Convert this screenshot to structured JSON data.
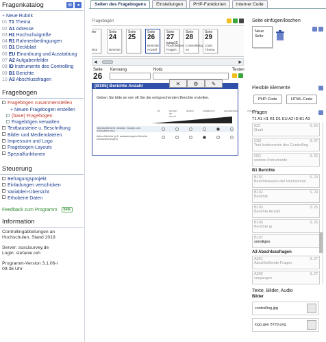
{
  "left": {
    "catalog_title": "Fragenkatalog",
    "catalog": [
      {
        "num": "",
        "code": "",
        "label": "Neue Rubrik",
        "new": true
      },
      {
        "num": "01",
        "code": "T1",
        "label": "Thema"
      },
      {
        "num": "02",
        "code": "A1",
        "label": "Adresse"
      },
      {
        "num": "03",
        "code": "H1",
        "label": "Hochschulgröße"
      },
      {
        "num": "04",
        "code": "R1",
        "label": "Rahmenbedingungen"
      },
      {
        "num": "05",
        "code": "D1",
        "label": "Deckblatt"
      },
      {
        "num": "06",
        "code": "EU",
        "label": "Einordnung und Ausstattung"
      },
      {
        "num": "07",
        "code": "A2",
        "label": "Aufgabenfelder"
      },
      {
        "num": "08",
        "code": "ID",
        "label": "Instrumente des Controlling"
      },
      {
        "num": "09",
        "code": "B1",
        "label": "Berichte"
      },
      {
        "num": "10",
        "code": "A3",
        "label": "Abschlussfragen"
      }
    ],
    "questionnaire_title": "Fragebogen",
    "nav1": [
      {
        "label": "Fragebögen zusammenstellen",
        "level": 0,
        "active": true
      },
      {
        "label": "+ Neuen Fragebogen erstellen",
        "level": 2
      },
      {
        "label": "(base) Fragebogen",
        "level": 1,
        "active": true
      },
      {
        "label": "Fragebögen verwalten",
        "level": 1
      },
      {
        "label": "Textbausteine u. Beschriftung",
        "level": 0
      },
      {
        "label": "Bilder und Mediendateien",
        "level": 0
      },
      {
        "label": "Impressum und Logo",
        "level": 0
      },
      {
        "label": "Fragebogen-Layouts",
        "level": 0
      },
      {
        "label": "Spezialfunktionen",
        "level": 0
      }
    ],
    "control_title": "Steuerung",
    "nav2": [
      {
        "label": "Befragungsprojekt"
      },
      {
        "label": "Einladungen verschicken"
      },
      {
        "label": "Variablen-Übersicht"
      },
      {
        "label": "Erhobene Daten"
      }
    ],
    "feedback": "Feedback zum Programm",
    "beta": "beta",
    "info_title": "Information",
    "info_lines": [
      "Controllingabteilungen an Hochschulen, Stand 2019",
      "Server: soscisurvey.de\nLogin: stefanie.reh",
      "Programm-Version 3.1.06-i\n09:36 Uhr"
    ]
  },
  "tabs": [
    "Seiten des Fragebogens",
    "Einstellungen",
    "PHP-Funktionen",
    "Interner Code"
  ],
  "editor": {
    "questionnaire_label": "Fragebogen",
    "page_label": "Seite",
    "pages": [
      {
        "num": "",
        "var": "",
        "desc": "rweise"
      },
      {
        "num": "24",
        "var": "",
        "desc": "Berichte"
      },
      {
        "num": "25",
        "var": "",
        "desc": ""
      },
      {
        "num": "26",
        "var": "",
        "desc": "Berichte Anzahl"
      },
      {
        "num": "27",
        "var": "jump10",
        "desc": "Abschließende Fragen"
      },
      {
        "num": "28",
        "var": "",
        "desc": "Controllertag es"
      },
      {
        "num": "29",
        "var": "",
        "desc": "Contr Thema"
      }
    ],
    "current_page": "26",
    "kennung_label": "Kennung",
    "notiz_label": "Notiz",
    "testen_label": "Testen",
    "question_title": "[B105] Berichte Anzahl",
    "question_text": "Geben Sie bitte an wie oft Sie die entsprechenden Berichte erstellen.",
    "scale_labels": [
      "nie",
      "weniger als einmal",
      "jährlich",
      "halbjährlich",
      "quartalsweise",
      "monatlich"
    ],
    "rows": [
      {
        "text": "Standardberichte (Analyse, Budget- und Kennzahlen etc.)",
        "selected": 4
      },
      {
        "text": "Adhoc-Berichte (z.B. anlassbezogene Berichte und Auswertungen)",
        "selected": 3
      }
    ]
  },
  "side": {
    "insert_title": "Seite einfügen/löschen",
    "new_page": "Neue Seite",
    "flex_title": "Flexible Elemente",
    "php_code": "PHP-Code",
    "html_code": "HTML-Code",
    "questions_title": "Fragen",
    "codes": "T1 A1 H1 R1 D1 EU A2 ID B1 A3",
    "items_top": [
      {
        "code": "022",
        "title": "Quali",
        "page": "S. 20"
      },
      {
        "code": "C03",
        "title": "Text Instrumente des Controlling",
        "page": "S. 07"
      },
      {
        "code": "O21",
        "title": "weitere Instrumente",
        "page": "S. 22"
      }
    ],
    "group1": "B1 Berichte",
    "items_b1": [
      {
        "code": "B101",
        "title": "Berichtswesen der Hochschule",
        "page": "S. 23"
      },
      {
        "code": "B102",
        "title": "Berichte",
        "page": "S. 24"
      },
      {
        "code": "B103",
        "title": "Berichte Anzahl",
        "page": "S. 25"
      },
      {
        "code": "B105",
        "title": "Berichte ja",
        "page": "S. 26"
      },
      {
        "code": "B107",
        "title": "sonstiges",
        "page": "",
        "dark": true
      }
    ],
    "group2": "A3 Abschlussfragen",
    "items_a3": [
      {
        "code": "A301",
        "title": "Abschließende Fragen",
        "page": "S. 27"
      },
      {
        "code": "A302",
        "title": "vergangen",
        "page": "S. 27"
      }
    ],
    "text_title": "Texte, Bilder, Audio",
    "images_title": "Bilder",
    "images": [
      "controlling.jpg",
      "logo.gen 8720.png"
    ]
  },
  "colors": {
    "accent": "#2f50a8",
    "link": "#1b3d8f",
    "active": "#c0392b",
    "green": "#2e8a2e"
  }
}
